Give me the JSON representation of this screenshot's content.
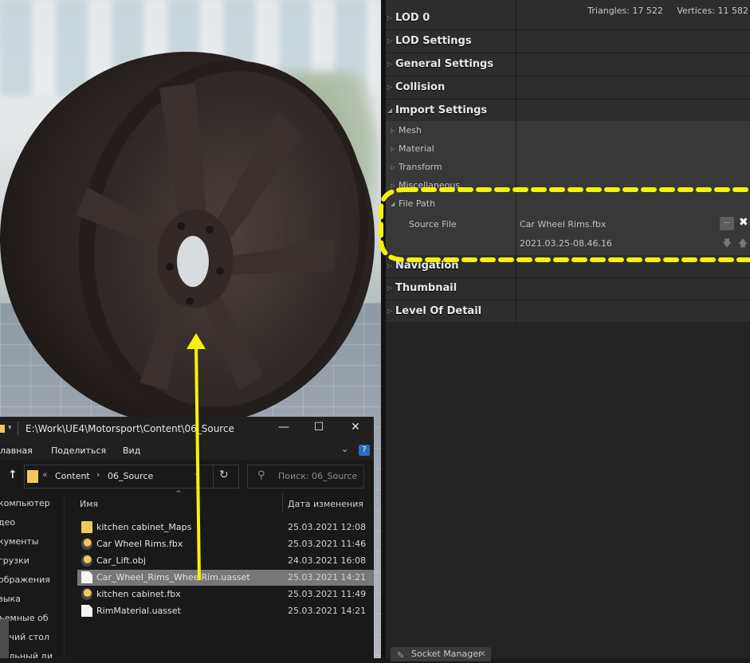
{
  "details": {
    "stats": {
      "triangles": "Triangles: 17 522",
      "vertices": "Vertices: 11 582"
    },
    "categories": [
      {
        "label": "LOD 0",
        "expanded": false
      },
      {
        "label": "LOD Settings",
        "expanded": false
      },
      {
        "label": "General Settings",
        "expanded": false
      },
      {
        "label": "Collision",
        "expanded": false
      },
      {
        "label": "Import Settings",
        "expanded": true
      }
    ],
    "import_subcategories": [
      "Mesh",
      "Material",
      "Transform",
      "Miscellaneous"
    ],
    "file_path": {
      "label": "File Path",
      "source_file_label": "Source File",
      "source_file_value": "Car Wheel Rims.fbx",
      "timestamp": "2021.03.25-08.46.16",
      "browse_label": "..."
    },
    "lower_categories": [
      "Navigation",
      "Thumbnail",
      "Level Of Detail"
    ],
    "bottom_tab": "Socket Manager"
  },
  "explorer": {
    "title": "E:\\Work\\UE4\\Motorsport\\Content\\06_Source",
    "ribbon": [
      "лавная",
      "Поделиться",
      "Вид"
    ],
    "breadcrumb": [
      "Content",
      "06_Source"
    ],
    "search_placeholder": "Поиск: 06_Source",
    "nav_items": [
      "компьютер",
      "део",
      "кументы",
      "грузки",
      "ображения",
      "зыка",
      "ъемные об",
      "бочий стол",
      "кальный ди"
    ],
    "columns": {
      "name": "Имя",
      "date": "Дата изменения"
    },
    "files": [
      {
        "name": "kitchen cabinet_Maps",
        "date": "25.03.2021 12:08",
        "icon": "folder-icon"
      },
      {
        "name": "Car Wheel Rims.fbx",
        "date": "25.03.2021 11:46",
        "icon": "unreal-file-icon"
      },
      {
        "name": "Car_Lift.obj",
        "date": "24.03.2021 16:08",
        "icon": "unreal-file-icon"
      },
      {
        "name": "Car_Wheel_Rims_WheelRim.uasset",
        "date": "25.03.2021 14:21",
        "icon": "document-icon",
        "selected": true
      },
      {
        "name": "kitchen cabinet.fbx",
        "date": "25.03.2021 11:49",
        "icon": "unreal-file-icon"
      },
      {
        "name": "RimMaterial.uasset",
        "date": "25.03.2021 14:21",
        "icon": "document-icon"
      }
    ]
  },
  "annotation_color": "#f5f20c"
}
